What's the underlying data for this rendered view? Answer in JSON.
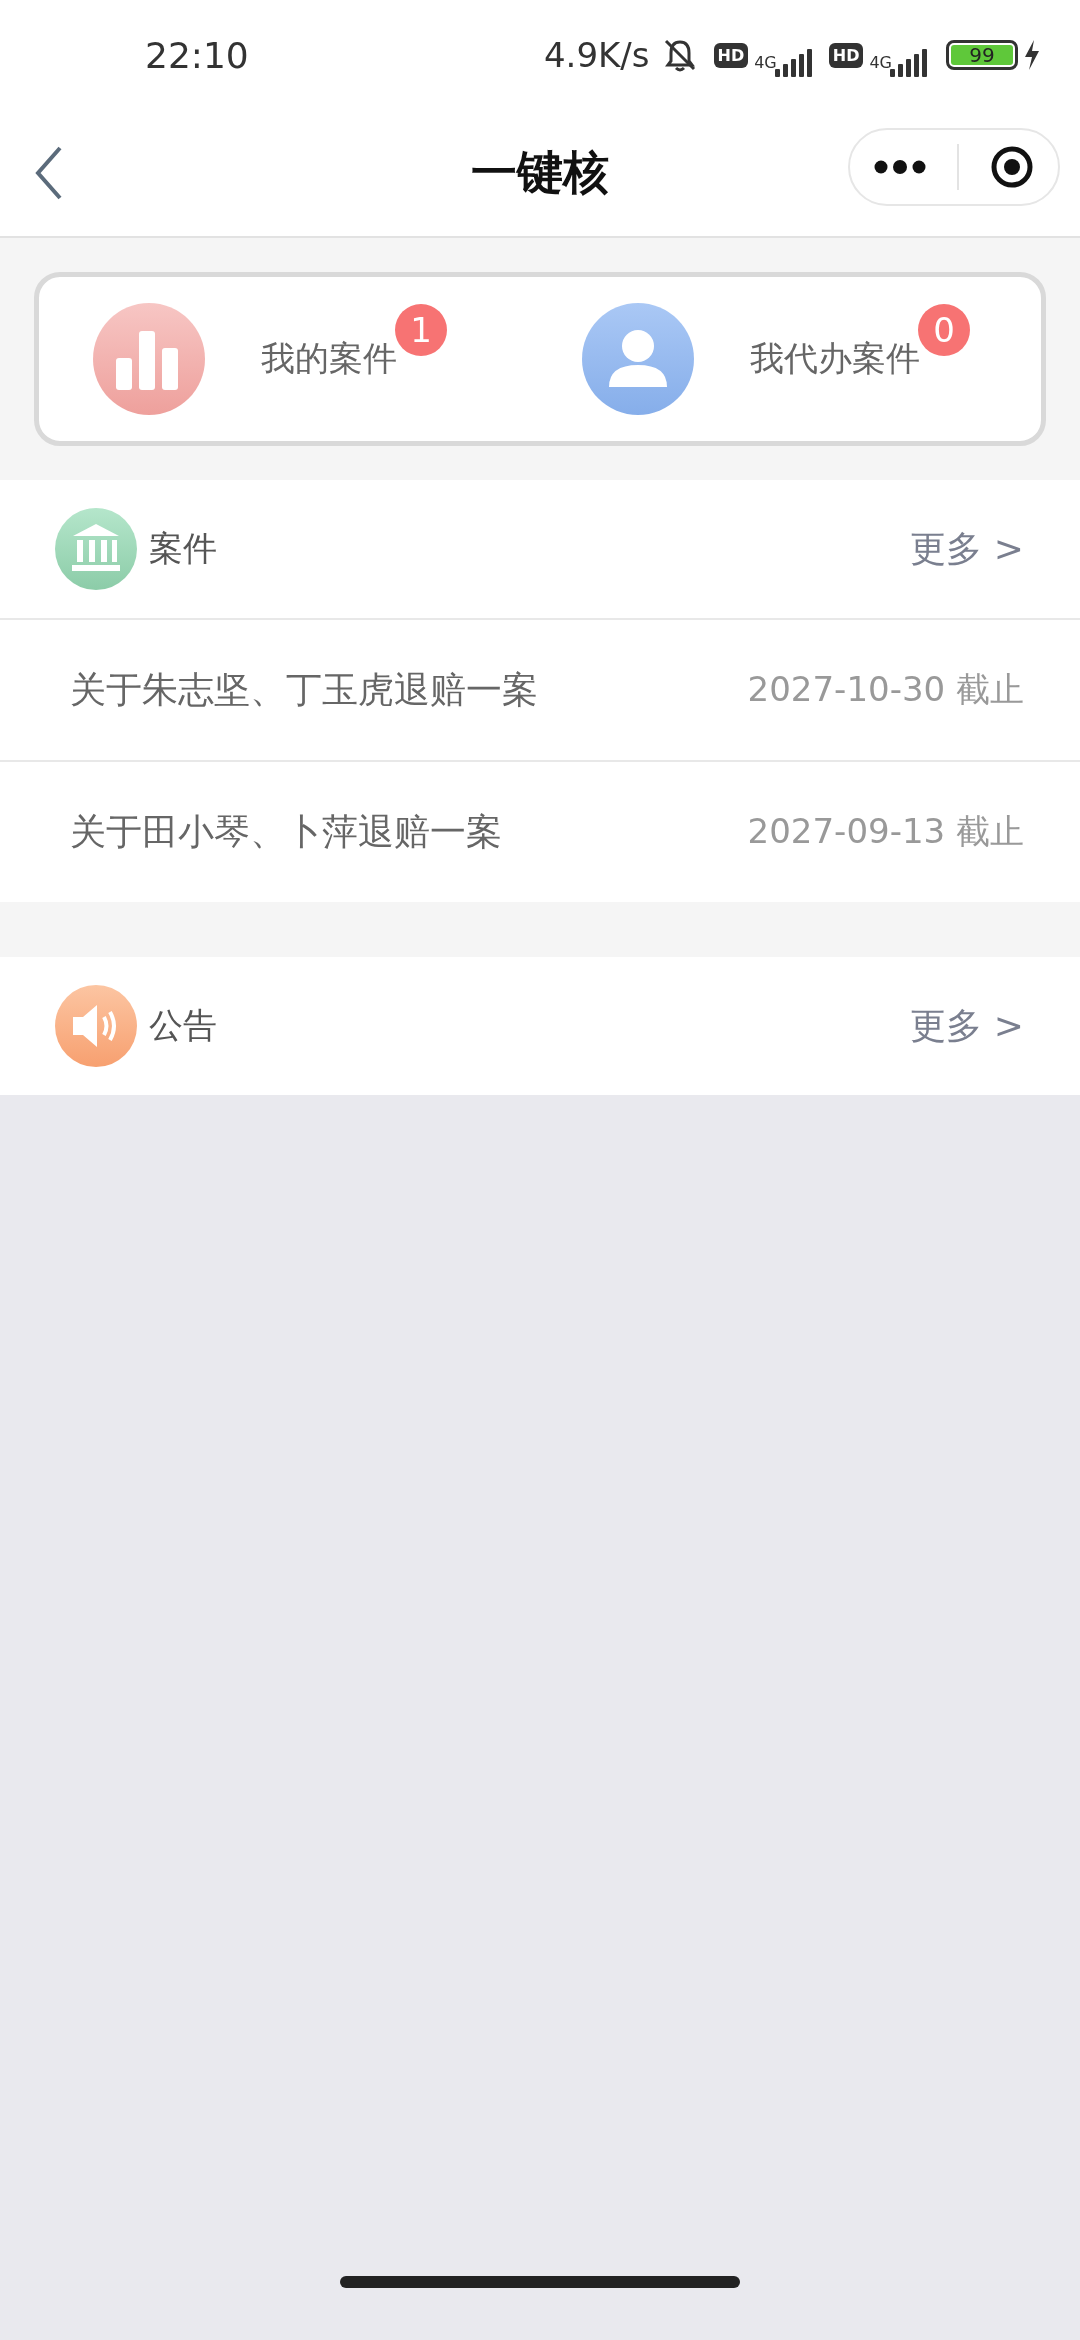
{
  "status_bar": {
    "time": "22:10",
    "speed": "4.9K/s",
    "sims": [
      {
        "hd": "HD",
        "network": "4G"
      },
      {
        "hd": "HD",
        "network": "4G"
      }
    ],
    "battery": "99",
    "charging": true
  },
  "nav": {
    "title": "一键核"
  },
  "shortcuts": [
    {
      "kind": "chart",
      "label": "我的案件",
      "count": "1"
    },
    {
      "kind": "person",
      "label": "我代办案件",
      "count": "0"
    }
  ],
  "sections": [
    {
      "kind": "bank",
      "title": "案件",
      "more": "更多 >",
      "items": [
        {
          "title": "关于朱志坚、丁玉虎退赔一案",
          "date": "2027-10-30 截止"
        },
        {
          "title": "关于田小琴、卜萍退赔一案",
          "date": "2027-09-13 截止"
        }
      ]
    },
    {
      "kind": "speaker",
      "title": "公告",
      "more": "更多 >"
    }
  ]
}
